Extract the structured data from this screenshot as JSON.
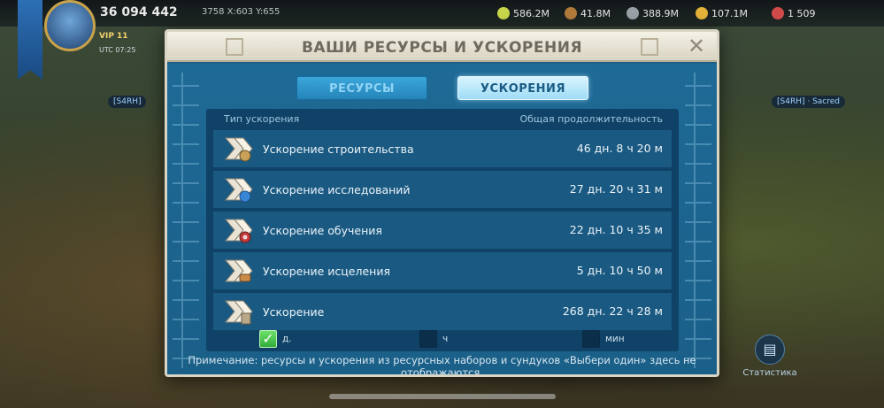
{
  "hud": {
    "power": "36 094 442",
    "coords": "3758 X:603 Y:655",
    "vip": "VIP 11",
    "utc": "UTC 07:25",
    "resources": [
      {
        "name": "food",
        "value": "586.2M",
        "color": "#c8d64a"
      },
      {
        "name": "wood",
        "value": "41.8M",
        "color": "#b07a3a"
      },
      {
        "name": "stone",
        "value": "388.9M",
        "color": "#9aa0a6"
      },
      {
        "name": "gold",
        "value": "107.1M",
        "color": "#e4b33a"
      },
      {
        "name": "gems",
        "value": "1 509",
        "color": "#d04a4a"
      }
    ],
    "left_tag": "[S4RH]",
    "right_tag": "[S4RH] · Sacred",
    "stats_label": "Статистика"
  },
  "modal": {
    "title": "ВАШИ РЕСУРСЫ И УСКОРЕНИЯ",
    "close_symbol": "✕",
    "tabs": [
      {
        "label": "РЕСУРСЫ",
        "active": false
      },
      {
        "label": "УСКОРЕНИЯ",
        "active": true
      }
    ],
    "table": {
      "col_type": "Тип ускорения",
      "col_duration": "Общая продолжительность",
      "rows": [
        {
          "name": "Ускорение строительства",
          "duration": "46 дн. 8 ч 20 м",
          "icon": "construction-speedup-icon",
          "badge": "#c9a25a"
        },
        {
          "name": "Ускорение исследований",
          "duration": "27 дн. 20 ч 31 м",
          "icon": "research-speedup-icon",
          "badge": "#3a86d6"
        },
        {
          "name": "Ускорение обучения",
          "duration": "22 дн. 10 ч 35 м",
          "icon": "training-speedup-icon",
          "badge": "#c23a3a"
        },
        {
          "name": "Ускорение исцеления",
          "duration": "5 дн. 10 ч 50 м",
          "icon": "healing-speedup-icon",
          "badge": "#c98a4a"
        },
        {
          "name": "Ускорение",
          "duration": "268 дн. 22 ч 28 м",
          "icon": "universal-speedup-icon",
          "badge": "#b9a88a"
        }
      ]
    },
    "filters": [
      {
        "label": "д.",
        "checked": true
      },
      {
        "label": "ч",
        "checked": false
      },
      {
        "label": "мин",
        "checked": false
      }
    ],
    "note": "Примечание: ресурсы и ускорения из ресурсных наборов и сундуков «Выбери один» здесь не отображаются."
  }
}
